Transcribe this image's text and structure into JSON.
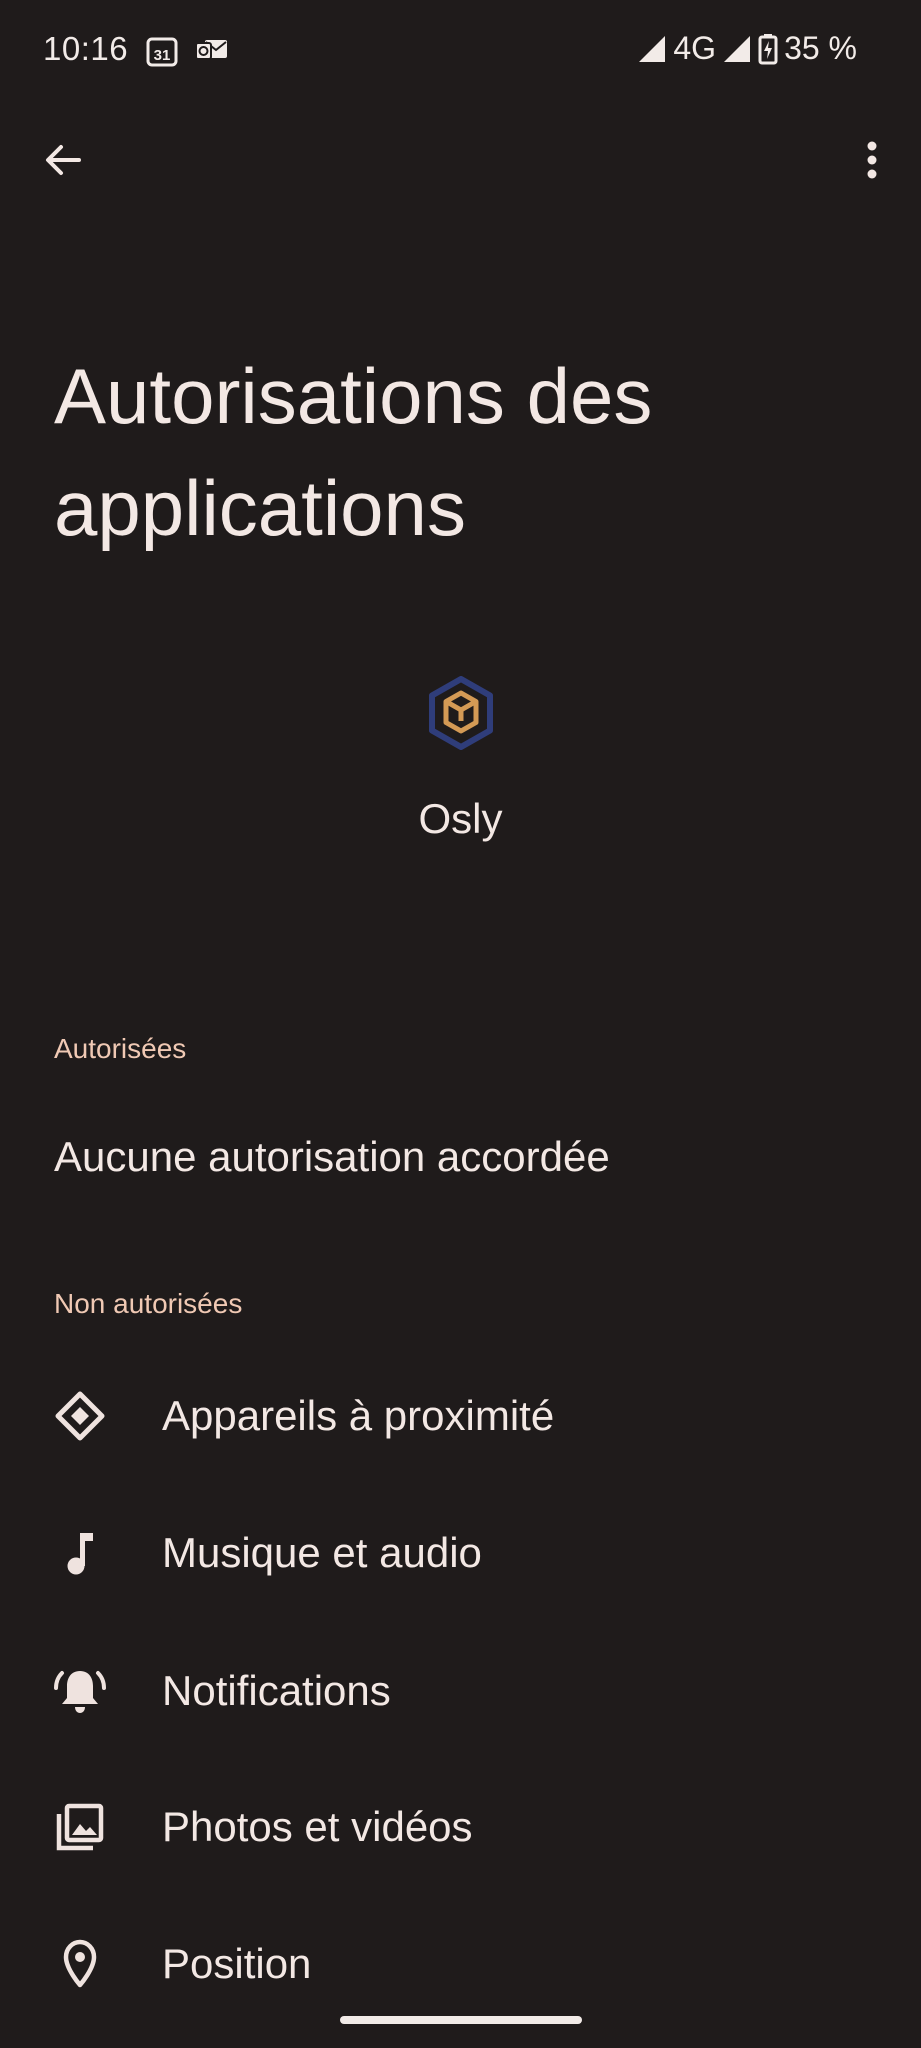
{
  "status_bar": {
    "time": "10:16",
    "calendar_day": "31",
    "network": "4G",
    "battery": "35 %"
  },
  "header": {
    "title": "Autorisations des applications"
  },
  "app": {
    "name": "Osly",
    "icon": "osly-hexagon-cube-icon"
  },
  "sections": {
    "allowed": {
      "header": "Autorisées",
      "empty_text": "Aucune autorisation accordée"
    },
    "not_allowed": {
      "header": "Non autorisées",
      "items": [
        {
          "label": "Appareils à proximité",
          "icon": "nearby-devices-icon"
        },
        {
          "label": "Musique et audio",
          "icon": "music-note-icon"
        },
        {
          "label": "Notifications",
          "icon": "bell-icon"
        },
        {
          "label": "Photos et vidéos",
          "icon": "photos-icon"
        },
        {
          "label": "Position",
          "icon": "location-pin-icon"
        }
      ]
    }
  },
  "colors": {
    "background": "#1f1b1b",
    "text": "#f3e8e4",
    "section_header": "#f0c9b4",
    "app_icon_hex": "#2f3d7a",
    "app_icon_cube": "#d49a55"
  }
}
